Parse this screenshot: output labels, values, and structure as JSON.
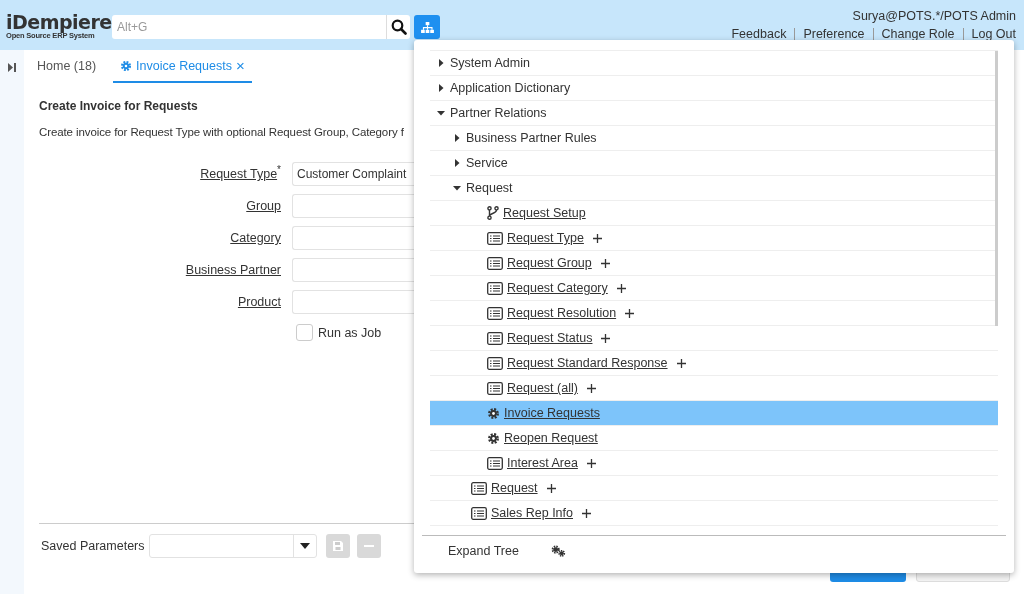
{
  "header": {
    "logo": "iDempiere",
    "logo_tagline": "Open Source ERP System",
    "search": {
      "placeholder": "Alt+G"
    },
    "user": "Surya@POTS.*/POTS Admin",
    "links": [
      "Feedback",
      "Preference",
      "Change Role",
      "Log Out"
    ]
  },
  "tabs": [
    {
      "label": "Home (18)",
      "selected": false,
      "kind": "home"
    },
    {
      "label": "Invoice Requests",
      "selected": true,
      "kind": "process",
      "close": "×"
    }
  ],
  "process": {
    "title": "Create Invoice for Requests",
    "description": "Create invoice for Request Type with optional Request Group, Category f",
    "parameters": [
      {
        "label": "Request Type",
        "marker": "*",
        "value": "Customer Complaint"
      },
      {
        "label": "Group"
      },
      {
        "label": "Category"
      },
      {
        "label": "Business Partner"
      },
      {
        "label": "Product"
      }
    ],
    "run_as_job": {
      "label": "Run as Job",
      "checked": false
    }
  },
  "saved_parameters": {
    "label": "Saved Parameters",
    "save_disabled": true,
    "delete_disabled": true
  },
  "menu_tree": [
    {
      "label": "System Admin",
      "kind": "folder",
      "expanded": false,
      "selected": false
    },
    {
      "label": "Application Dictionary",
      "kind": "folder",
      "expanded": false,
      "selected": false
    },
    {
      "label": "Partner Relations",
      "kind": "folder",
      "expanded": true,
      "selected": false,
      "children": [
        {
          "label": "Business Partner Rules",
          "kind": "folder",
          "expanded": false,
          "selected": false
        },
        {
          "label": "Service",
          "kind": "folder",
          "expanded": false,
          "selected": false
        },
        {
          "label": "Request",
          "kind": "folder",
          "expanded": true,
          "selected": false,
          "children": [
            {
              "label": "Request Setup",
              "kind": "workflow",
              "selected": false
            },
            {
              "label": "Request Type",
              "kind": "window",
              "selected": false
            },
            {
              "label": "Request Group",
              "kind": "window",
              "selected": false
            },
            {
              "label": "Request Category",
              "kind": "window",
              "selected": false
            },
            {
              "label": "Request Resolution",
              "kind": "window",
              "selected": false
            },
            {
              "label": "Request Status",
              "kind": "window",
              "selected": false
            },
            {
              "label": "Request Standard Response",
              "kind": "window",
              "selected": false
            },
            {
              "label": "Request (all)",
              "kind": "window",
              "selected": false
            },
            {
              "label": "Invoice Requests",
              "kind": "process",
              "selected": true
            },
            {
              "label": "Reopen Request",
              "kind": "process",
              "selected": false
            },
            {
              "label": "Interest Area",
              "kind": "window",
              "selected": false
            }
          ]
        },
        {
          "label": "Request",
          "kind": "window",
          "selected": false
        },
        {
          "label": "Sales Rep Info",
          "kind": "window",
          "selected": false
        }
      ]
    }
  ],
  "expand_tree": {
    "label": "Expand Tree"
  }
}
